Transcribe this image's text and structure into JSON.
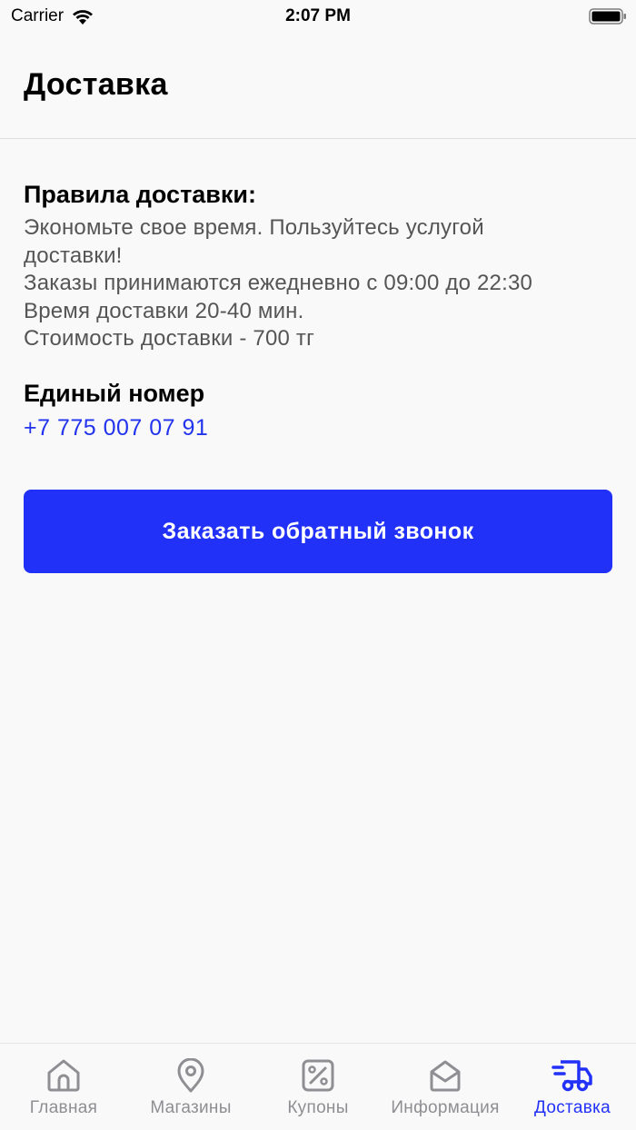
{
  "status_bar": {
    "carrier": "Carrier",
    "time": "2:07 PM"
  },
  "header": {
    "title": "Доставка"
  },
  "rules": {
    "title": "Правила доставки:",
    "lines": [
      "Экономьте свое время. Пользуйтесь услугой",
      "доставки!",
      "Заказы принимаются ежедневно с 09:00 до 22:30",
      "Время доставки 20-40 мин.",
      "Стоимость доставки - 700 тг"
    ]
  },
  "phone": {
    "title": "Единый номер",
    "number": "+7 775 007 07 91"
  },
  "callback_button": {
    "label": "Заказать обратный звонок"
  },
  "tab_bar": {
    "active_tab": "Доставка",
    "accent_color": "#2231f8",
    "inactive_color": "#8e8e93",
    "tabs": [
      {
        "label": "Главная",
        "icon": "home-icon"
      },
      {
        "label": "Магазины",
        "icon": "map-pin-icon"
      },
      {
        "label": "Купоны",
        "icon": "percent-coupon-icon"
      },
      {
        "label": "Информация",
        "icon": "envelope-icon"
      },
      {
        "label": "Доставка",
        "icon": "delivery-truck-icon"
      }
    ]
  }
}
